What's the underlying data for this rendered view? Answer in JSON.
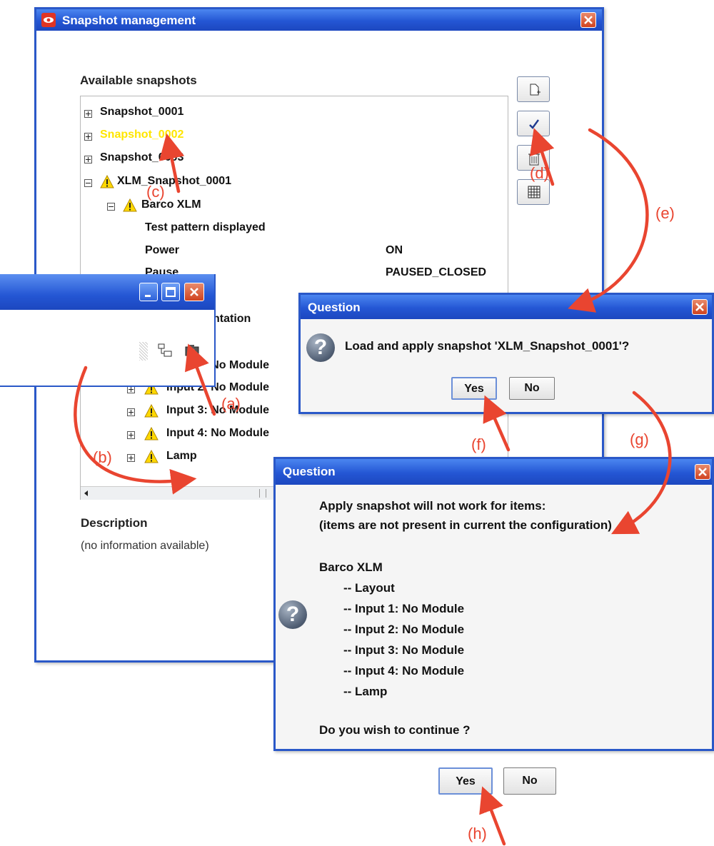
{
  "main_window": {
    "title": "Snapshot management",
    "available_label": "Available snapshots",
    "description_label": "Description",
    "description_text": "(no information available)",
    "tree": [
      {
        "label": "Snapshot_0001"
      },
      {
        "label": "Snapshot_0002"
      },
      {
        "label": "Snapshot_0003"
      },
      {
        "label": "XLM_Snapshot_0001"
      },
      {
        "label": "Barco XLM"
      },
      {
        "label": "Test pattern displayed"
      },
      {
        "label": "Power",
        "value": "ON"
      },
      {
        "label": "Pause",
        "value": "PAUSED_CLOSED"
      },
      {
        "label": "Input 1: No Module"
      },
      {
        "label": "Input 2: No Module"
      },
      {
        "label": "Input 3: No Module"
      },
      {
        "label": "Input 4: No Module"
      },
      {
        "label": "Lamp"
      }
    ],
    "partial_text": "ntation",
    "highlight_color": "#ffe600",
    "toolbar_icons": [
      "new-snapshot-icon",
      "apply-checkmark-icon",
      "delete-trash-icon",
      "grid-table-icon"
    ]
  },
  "small_window": {
    "icons": [
      "minimize-icon",
      "maximize-icon",
      "close-icon",
      "layout-icon",
      "camera-icon"
    ]
  },
  "question1": {
    "title": "Question",
    "message": "Load and apply snapshot 'XLM_Snapshot_0001'?",
    "yes": "Yes",
    "no": "No"
  },
  "question2": {
    "title": "Question",
    "lines": [
      "Apply snapshot will not work for items:",
      "(items are not present in current the configuration)",
      "",
      "Barco XLM",
      "-- Layout",
      "-- Input 1: No Module",
      "-- Input 2: No Module",
      "-- Input 3: No Module",
      "-- Input 4: No Module",
      "-- Lamp",
      "",
      "Do you wish to continue ?"
    ],
    "yes": "Yes",
    "no": "No"
  },
  "annotations": [
    "(a)",
    "(b)",
    "(c)",
    "(d)",
    "(e)",
    "(f)",
    "(g)",
    "(h)"
  ],
  "colors": {
    "title_blue": "#2456d4",
    "annotation_red": "#e94530",
    "warning_yellow": "#ffd800"
  }
}
